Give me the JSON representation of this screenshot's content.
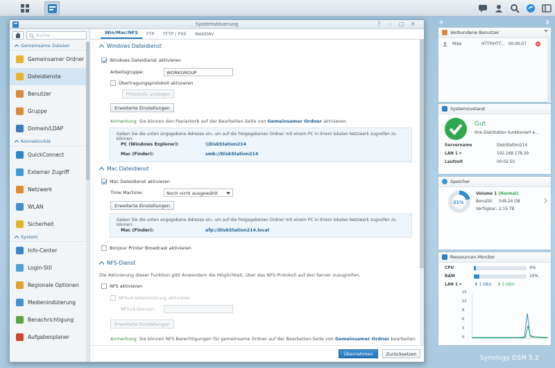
{
  "window": {
    "title": "Systemsteuerung",
    "ctl_help": "?",
    "ctl_min": "–",
    "ctl_max": "□",
    "ctl_close": "✕"
  },
  "sidebar": {
    "search_placeholder": "Suche",
    "sections": [
      {
        "title": "Gemeinsame Dateien",
        "items": [
          {
            "label": "Gemeinsamer Ordner",
            "icon": "folder-icon",
            "color": "#e9b22d"
          },
          {
            "label": "Dateidienste",
            "icon": "file-services-icon",
            "color": "#e9b22d",
            "active": true
          },
          {
            "label": "Benutzer",
            "icon": "user-icon",
            "color": "#d98b3d"
          },
          {
            "label": "Gruppe",
            "icon": "group-icon",
            "color": "#d98b3d"
          },
          {
            "label": "Domain/LDAP",
            "icon": "domain-icon",
            "color": "#3a7cc1"
          }
        ]
      },
      {
        "title": "Konnektivität",
        "items": [
          {
            "label": "QuickConnect",
            "icon": "quickconnect-icon",
            "color": "#2c89c9"
          },
          {
            "label": "Externer Zugriff",
            "icon": "globe-icon",
            "color": "#3c9bd6"
          },
          {
            "label": "Netzwerk",
            "icon": "network-icon",
            "color": "#e08b2c"
          },
          {
            "label": "WLAN",
            "icon": "wifi-icon",
            "color": "#3c8fd0"
          },
          {
            "label": "Sicherheit",
            "icon": "shield-icon",
            "color": "#e3b32a"
          }
        ]
      },
      {
        "title": "System",
        "items": [
          {
            "label": "Info-Center",
            "icon": "info-icon",
            "color": "#3a86c9"
          },
          {
            "label": "Login-Stil",
            "icon": "login-style-icon",
            "color": "#4d9fd8"
          },
          {
            "label": "Regionale Optionen",
            "icon": "clock-icon",
            "color": "#e0a22d"
          },
          {
            "label": "Medienindizierung",
            "icon": "media-index-icon",
            "color": "#3f93d1"
          },
          {
            "label": "Benachrichtigung",
            "icon": "notification-icon",
            "color": "#5aa643"
          },
          {
            "label": "Aufgabenplaner",
            "icon": "calendar-icon",
            "color": "#d0452e"
          }
        ]
      }
    ]
  },
  "tabs": [
    "Win/Mac/NFS",
    "FTP",
    "TFTP / PXE",
    "WebDAV"
  ],
  "windows": {
    "title": "Windows Dateidienst",
    "enable_label": "Windows Dateidienst aktivieren",
    "workgroup_label": "Arbeitsgruppe:",
    "workgroup_value": "WORKGROUP",
    "transfer_log_label": "Übertragungsprotokoll aktivieren",
    "show_log_button": "Protokolle anzeigen",
    "advanced_button": "Erweiterte Einstellungen",
    "note_prefix": "Anmerkung:",
    "note_text": "Sie können den Papierkorb auf der Bearbeiten-Seite von",
    "note_link": "Gemeinsamer Ordner",
    "note_suffix": "aktivieren.",
    "info_text": "Geben Sie die unten angegebene Adresse ein, um auf die freigegebenen Ordner mit einem PC in Ihrem lokalen Netzwerk zugreifen zu können:",
    "pc_label": "PC (Windows Explorer):",
    "pc_value": "\\\\DiskStation214",
    "mac_label": "Mac (Finder):",
    "mac_value": "smb://DiskStation214"
  },
  "mac": {
    "title": "Mac Dateidienst",
    "enable_label": "Mac Dateidienst aktivieren",
    "time_machine_label": "Time Machine:",
    "time_machine_value": "Noch nicht ausgewählt",
    "advanced_button": "Erweiterte Einstellungen",
    "info_text": "Geben Sie die unten angegebene Adresse ein, um auf die freigegebenen Ordner mit einem PC in Ihrem lokalen Netzwerk zugreifen zu können:",
    "mac_label": "Mac (Finder):",
    "mac_value": "afp://DiskStation214.local"
  },
  "bonjour_label": "Bonjour Printer Broadcast aktivieren",
  "nfs": {
    "title": "NFS-Dienst",
    "description": "Die Aktivierung dieser Funktion gibt Anwendern die Möglichkeit, über das NFS-Protokoll auf den Server zuzugreifen.",
    "enable_label": "NFS aktivieren",
    "nfsv4_label": "NFSv4-Unterstützung aktivieren",
    "domain_label": "NFSv4-Domain:",
    "advanced_button": "Erweiterte Einstellungen",
    "note_prefix": "Anmerkung:",
    "note_text": "Sie können NFS Berechtigungen für gemeinsame Ordner auf der Bearbeiten-Seite von",
    "note_link": "Gemeinsamer Ordner",
    "note_suffix": "bearbeiten."
  },
  "footer": {
    "apply": "Übernehmen",
    "reset": "Zurücksetzen"
  },
  "widgets": {
    "add": "+",
    "users": {
      "title": "Verbundene Benutzer",
      "name": "Mike",
      "protocol": "HTTP/HTT...",
      "time": "00:00:07"
    },
    "health": {
      "title": "Systemzustand",
      "status": "Gut",
      "message": "Ihre DiskStation funktioniert e...",
      "rows": [
        {
          "label": "Servername",
          "value": "DiskStation214"
        },
        {
          "label": "LAN 1 ▾",
          "value": "192.168.178.39"
        },
        {
          "label": "Laufzeit",
          "value": "00:02:50"
        }
      ]
    },
    "storage": {
      "title": "Speicher",
      "percent": "21%",
      "percent_value": 21,
      "volume": "Volume 1",
      "volume_status": "(Normal)",
      "used_label": "Benutzt:",
      "used_value": "549.24 GB",
      "free_label": "Verfügbar:",
      "free_value": "2.15 TB"
    },
    "resources": {
      "title": "Ressourcen-Monitor",
      "cpu_label": "CPU",
      "cpu_percent": "4%",
      "cpu_value": 4,
      "ram_label": "RAM",
      "ram_percent": "10%",
      "ram_value": 10,
      "lan_label": "LAN 1 ▾",
      "up": "1 kB/s",
      "down": "1 kB/s",
      "y_ticks": [
        "15",
        "12",
        "9",
        "6",
        "3",
        "0"
      ]
    }
  },
  "brand": "Synology DSM 5.2",
  "colors": {
    "accent": "#2b79b9",
    "ok": "#2fa84f",
    "danger": "#d9443c"
  }
}
